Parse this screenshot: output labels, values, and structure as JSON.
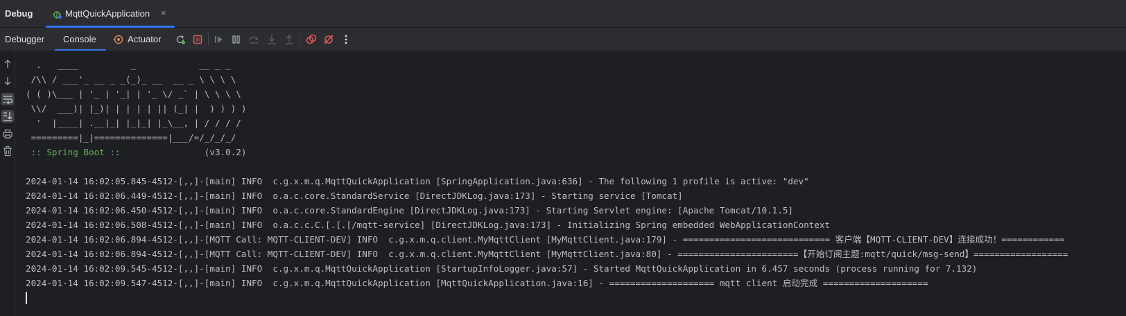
{
  "tool_window": {
    "title": "Debug",
    "run_tab": {
      "label": "MqttQuickApplication",
      "close": "×"
    }
  },
  "toolbar": {
    "tabs": [
      {
        "label": "Debugger"
      },
      {
        "label": "Console",
        "active": true
      },
      {
        "label": "Actuator"
      }
    ],
    "actions": [
      "rerun-icon",
      "stop-icon",
      "resume-icon",
      "pause-icon",
      "step-over-icon",
      "step-into-icon",
      "step-out-icon",
      "view-breakpoints-icon",
      "mute-breakpoints-icon",
      "more-icon"
    ]
  },
  "gutter": {
    "actions": [
      "scroll-up-icon",
      "scroll-down-icon",
      "soft-wrap-icon",
      "scroll-to-end-icon",
      "print-icon",
      "clear-all-icon"
    ]
  },
  "console": {
    "banner": [
      "  .   ____          _            __ _ _",
      " /\\\\ / ___'_ __ _ _(_)_ __  __ _ \\ \\ \\ \\",
      "( ( )\\___ | '_ | '_| | '_ \\/ _` | \\ \\ \\ \\",
      " \\\\/  ___)| |_)| | | | | || (_| |  ) ) ) )",
      "  '  |____| .__|_| |_|_| |_\\__, | / / / /",
      " =========|_|==============|___/=/_/_/_/"
    ],
    "spring_label": " :: Spring Boot :: ",
    "spring_version": "               (v3.0.2)",
    "logs": [
      "2024-01-14 16:02:05.845-4512-[,,]-[main] INFO  c.g.x.m.q.MqttQuickApplication [SpringApplication.java:636] - The following 1 profile is active: \"dev\"",
      "2024-01-14 16:02:06.449-4512-[,,]-[main] INFO  o.a.c.core.StandardService [DirectJDKLog.java:173] - Starting service [Tomcat]",
      "2024-01-14 16:02:06.450-4512-[,,]-[main] INFO  o.a.c.core.StandardEngine [DirectJDKLog.java:173] - Starting Servlet engine: [Apache Tomcat/10.1.5]",
      "2024-01-14 16:02:06.508-4512-[,,]-[main] INFO  o.a.c.c.C.[.[.[/mqtt-service] [DirectJDKLog.java:173] - Initializing Spring embedded WebApplicationContext",
      "2024-01-14 16:02:06.894-4512-[,,]-[MQTT Call: MQTT-CLIENT-DEV] INFO  c.g.x.m.q.client.MyMqttClient [MyMqttClient.java:179] - ============================ 客户端【MQTT-CLIENT-DEV】连接成功！============",
      "2024-01-14 16:02:06.894-4512-[,,]-[MQTT Call: MQTT-CLIENT-DEV] INFO  c.g.x.m.q.client.MyMqttClient [MyMqttClient.java:80] - =======================【开始订阅主题:mqtt/quick/msg-send】==================",
      "2024-01-14 16:02:09.545-4512-[,,]-[main] INFO  c.g.x.m.q.MqttQuickApplication [StartupInfoLogger.java:57] - Started MqttQuickApplication in 6.457 seconds (process running for 7.132)",
      "2024-01-14 16:02:09.547-4512-[,,]-[main] INFO  c.g.x.m.q.MqttQuickApplication [MqttQuickApplication.java:16] - ==================== mqtt client 启动完成 ===================="
    ]
  },
  "colors": {
    "accent": "#3574f0",
    "stop": "#db5c5c",
    "rerun": "#5fb157",
    "breakpoint": "#e55757"
  }
}
